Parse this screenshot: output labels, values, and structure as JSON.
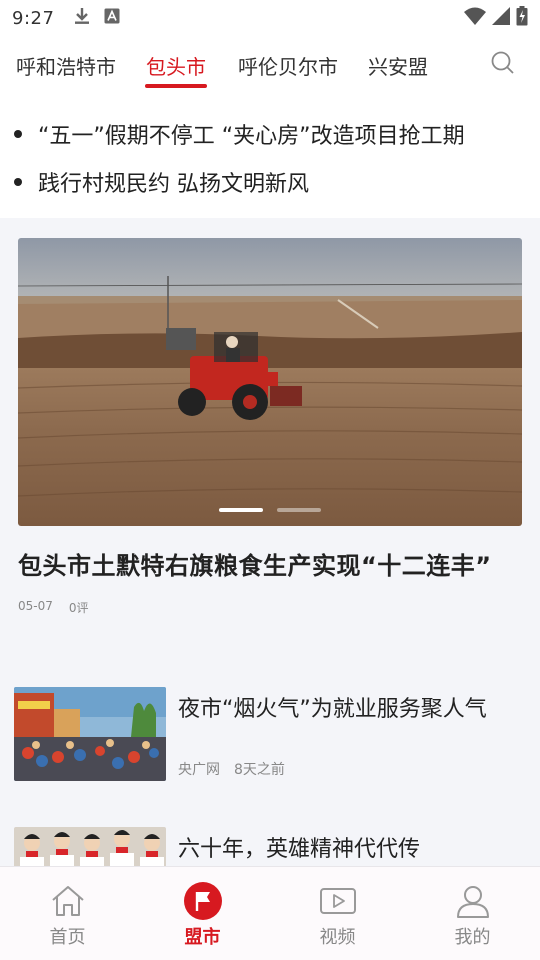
{
  "status_bar": {
    "time": "9:27"
  },
  "city_tabs": [
    {
      "label": "呼和浩特市"
    },
    {
      "label": "包头市",
      "active": true
    },
    {
      "label": "呼伦贝尔市"
    },
    {
      "label": "兴安盟"
    }
  ],
  "headlines": [
    {
      "text": "“五一”假期不停工 “夹心房”改造项目抢工期"
    },
    {
      "text": "践行村规民约 弘扬文明新风"
    }
  ],
  "feature": {
    "title": "包头市土默特右旗粮食生产实现“十二连丰”",
    "date": "05-07",
    "comments": "0评",
    "carousel_active_index": 0,
    "carousel_count": 2
  },
  "news": [
    {
      "title": "夜市“烟火气”为就业服务聚人气",
      "source": "央广网",
      "time": "8天之前"
    },
    {
      "title": "六十年，英雄精神代代传",
      "source": "",
      "time": ""
    }
  ],
  "bottom_nav": [
    {
      "label": "首页",
      "icon": "home-icon"
    },
    {
      "label": "盟市",
      "icon": "flag-icon",
      "active": true
    },
    {
      "label": "视频",
      "icon": "video-icon"
    },
    {
      "label": "我的",
      "icon": "user-icon"
    }
  ],
  "colors": {
    "accent": "#d71920",
    "background": "#f4f5f9"
  }
}
